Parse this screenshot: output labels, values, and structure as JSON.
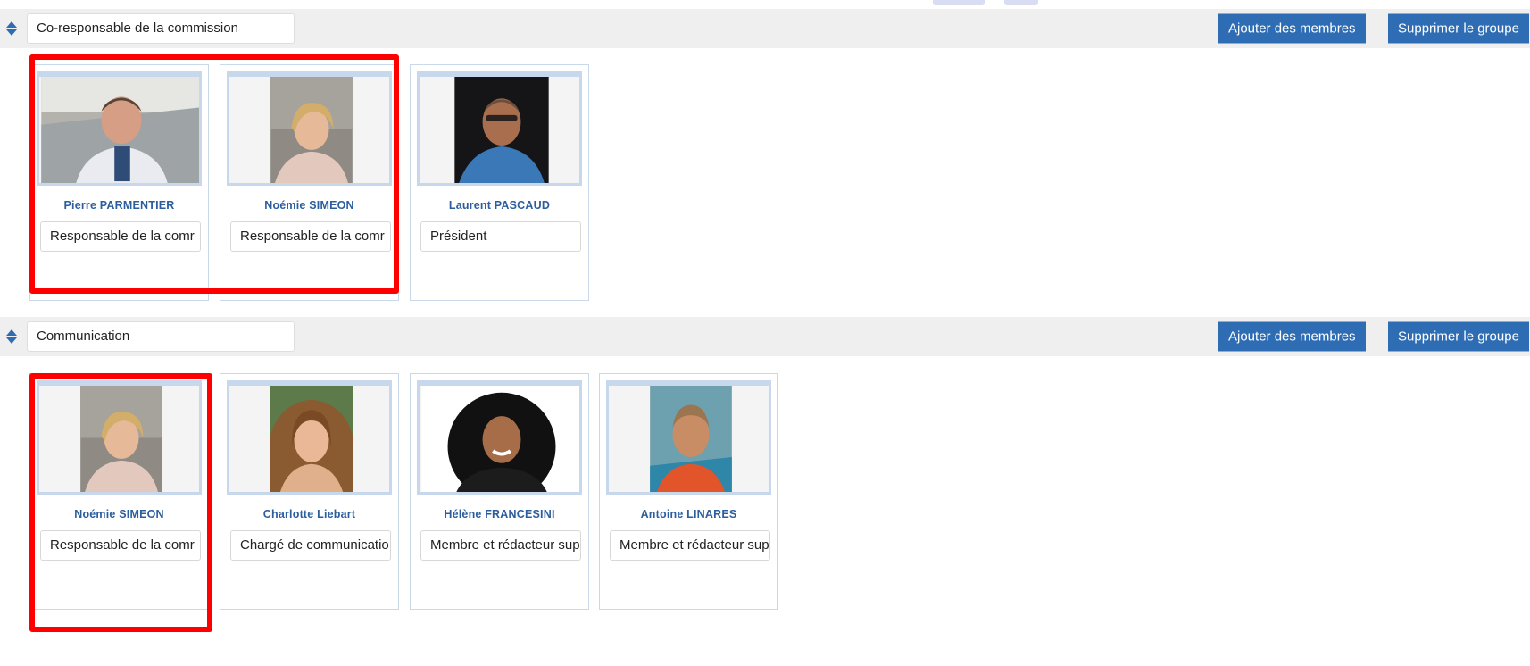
{
  "colors": {
    "accent_button": "#2e6db4",
    "name_text": "#2c5e9e",
    "highlight": "#ff0000",
    "header_bg": "#efefef"
  },
  "groups": [
    {
      "name": "Co-responsable de la commission",
      "add_label": "Ajouter des membres",
      "delete_label": "Supprimer le groupe",
      "members": [
        {
          "name": "Pierre PARMENTIER",
          "role": "Responsable de la comr",
          "photo": "man-portrait-icon"
        },
        {
          "name": "Noémie SIMEON",
          "role": "Responsable de la comr",
          "photo": "woman-portrait-icon"
        },
        {
          "name": "Laurent PASCAUD",
          "role": "Président",
          "photo": "man-portrait-icon"
        }
      ]
    },
    {
      "name": "Communication",
      "add_label": "Ajouter des membres",
      "delete_label": "Supprimer le groupe",
      "members": [
        {
          "name": "Noémie SIMEON",
          "role": "Responsable de la comr",
          "photo": "woman-portrait-icon"
        },
        {
          "name": "Charlotte Liebart",
          "role": "Chargé de communicatio",
          "photo": "woman-portrait-icon"
        },
        {
          "name": "Hélène FRANCESINI",
          "role": "Membre et rédacteur sup",
          "photo": "woman-portrait-icon"
        },
        {
          "name": "Antoine LINARES",
          "role": "Membre et rédacteur sup",
          "photo": "man-portrait-icon"
        }
      ]
    }
  ]
}
